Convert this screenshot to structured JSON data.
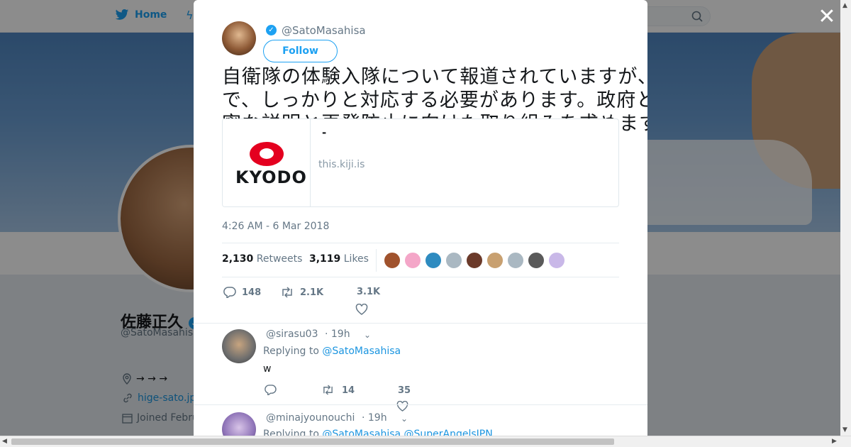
{
  "topnav": {
    "home_label": "Home",
    "search_icon": "search-icon"
  },
  "profile": {
    "name": "佐藤正久",
    "handle": "@SatoMasahisa",
    "location": "→ → →",
    "link": "hige-sato.jp",
    "joined": "Joined Febru"
  },
  "tweet": {
    "author_handle": "@SatoMasahisa",
    "follow_label": "Follow",
    "text": "自衛隊の体験入隊について報道されていますが、事実関係を確認した上で、しっかりと対応する必要があります。政府として、国民に対する丁寧な説明と再発防止に向けた取り組みを求めます。",
    "card": {
      "logo_text": "KYODO",
      "title": "-",
      "domain": "this.kiji.is"
    },
    "timestamp": "4:26 AM - 6 Mar 2018",
    "retweets_count": "2,130",
    "retweets_label": "Retweets",
    "likes_count": "3,119",
    "likes_label": "Likes",
    "liker_colors": [
      "#a0522d",
      "#f4a6c8",
      "#2e8bc0",
      "#aab8c2",
      "#6b3a2a",
      "#c8a070",
      "#aab8c2",
      "#5a5a5a",
      "#c9b8e8"
    ],
    "actions": {
      "reply_count": "148",
      "retweet_count": "2.1K",
      "like_count": "3.1K"
    }
  },
  "replies": [
    {
      "handle": "@sirasu03",
      "time": "· 19h",
      "replying_prefix": "Replying to",
      "mentions": [
        "@SatoMasahisa"
      ],
      "text": "w",
      "retweet_count": "14",
      "like_count": "35"
    },
    {
      "handle": "@minajyounouchi",
      "time": "· 19h",
      "replying_prefix": "Replying to",
      "mentions": [
        "@SatoMasahisa",
        "@SuperAngelsJPN"
      ],
      "text": "",
      "retweet_count": "",
      "like_count": ""
    }
  ],
  "colors": {
    "accent": "#1da1f2",
    "link": "#1b95e0",
    "muted": "#657786",
    "kyodo_red": "#e4001f"
  }
}
